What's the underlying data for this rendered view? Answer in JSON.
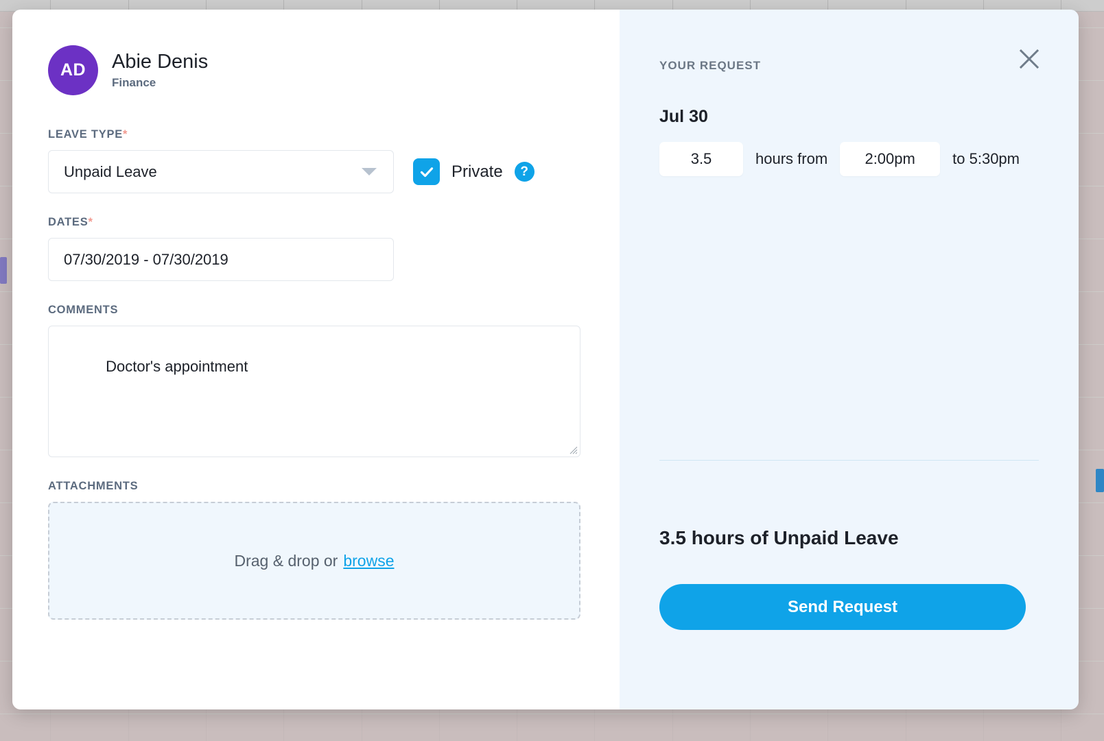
{
  "background": {
    "event_left_color": "#8179c0",
    "event_right_color": "#2f86c5",
    "surface_color": "#c9bdbd"
  },
  "modal": {
    "form": {
      "avatar_initials": "AD",
      "person_name": "Abie Denis",
      "person_department": "Finance",
      "leave_type": {
        "label": "LEAVE TYPE",
        "required_mark": "*",
        "value": "Unpaid Leave",
        "caret_icon": "chevron-down-icon"
      },
      "private": {
        "label": "Private",
        "checked": true,
        "help_icon": "?"
      },
      "dates": {
        "label": "DATES",
        "required_mark": "*",
        "value": "07/30/2019 - 07/30/2019"
      },
      "comments": {
        "label": "COMMENTS",
        "value": "Doctor's appointment",
        "placeholder": ""
      },
      "attachments": {
        "label": "ATTACHMENTS",
        "prompt": "Drag & drop or",
        "browse_label": "browse"
      }
    },
    "summary": {
      "title": "YOUR REQUEST",
      "close_icon": "close-icon",
      "date": "Jul 30",
      "hours_value": "3.5",
      "hours_from_label": "hours from",
      "start_time": "2:00pm",
      "to_time_label": "to 5:30pm",
      "total_text": "3.5 hours of Unpaid Leave",
      "send_button_label": "Send Request",
      "accent_color": "#0fa3e8"
    }
  }
}
